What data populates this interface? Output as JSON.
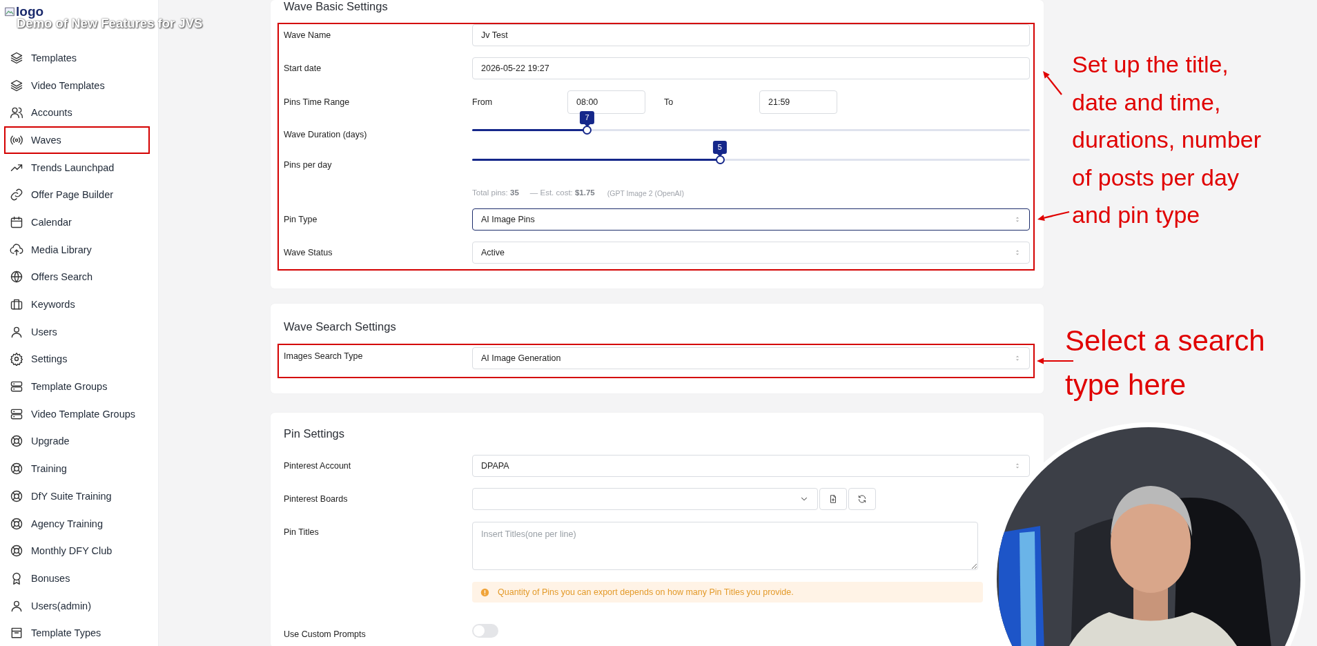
{
  "logo": {
    "alt_text": "logo"
  },
  "video_title": "Demo of New Features for JVS",
  "sidebar": {
    "items": [
      {
        "label": "Templates",
        "highlighted": false
      },
      {
        "label": "Video Templates",
        "highlighted": false
      },
      {
        "label": "Accounts",
        "highlighted": false
      },
      {
        "label": "Waves",
        "highlighted": true
      },
      {
        "label": "Trends Launchpad",
        "highlighted": false
      },
      {
        "label": "Offer Page Builder",
        "highlighted": false
      },
      {
        "label": "Calendar",
        "highlighted": false
      },
      {
        "label": "Media Library",
        "highlighted": false
      },
      {
        "label": "Offers Search",
        "highlighted": false
      },
      {
        "label": "Keywords",
        "highlighted": false
      },
      {
        "label": "Users",
        "highlighted": false
      },
      {
        "label": "Settings",
        "highlighted": false
      },
      {
        "label": "Template Groups",
        "highlighted": false
      },
      {
        "label": "Video Template Groups",
        "highlighted": false
      },
      {
        "label": "Upgrade",
        "highlighted": false
      },
      {
        "label": "Training",
        "highlighted": false
      },
      {
        "label": "DfY Suite Training",
        "highlighted": false
      },
      {
        "label": "Agency Training",
        "highlighted": false
      },
      {
        "label": "Monthly DFY Club",
        "highlighted": false
      },
      {
        "label": "Bonuses",
        "highlighted": false
      },
      {
        "label": "Users(admin)",
        "highlighted": false
      },
      {
        "label": "Template Types",
        "highlighted": false
      }
    ]
  },
  "sections": [
    {
      "title": "Wave Basic Settings",
      "highlighted": true,
      "fields": [
        {
          "kind": "input",
          "label": "Wave Name",
          "value": "Jv Test"
        },
        {
          "kind": "input",
          "label": "Start date",
          "value": "2026-05-22 19:27"
        },
        {
          "kind": "time_range",
          "label": "Pins Time Range",
          "from_label": "From",
          "from_value": "08:00",
          "to_label": "To",
          "to_value": "21:59"
        },
        {
          "kind": "slider",
          "label": "Wave Duration (days)",
          "level": 0.206,
          "reading": "7"
        },
        {
          "kind": "slider",
          "label": "Pins per day",
          "level": 0.444,
          "reading": "5"
        },
        {
          "kind": "summary",
          "total": "Total pins: **35**",
          "cost": "— Est. cost: **$1.75**",
          "model": "(GPT Image 2 (OpenAI)"
        },
        {
          "kind": "select",
          "label": "Pin Type",
          "value": "AI Image Pins",
          "focused": true
        },
        {
          "kind": "select",
          "label": "Wave Status",
          "value": "Active",
          "focused": false
        }
      ]
    },
    {
      "title": "Wave Search Settings",
      "highlighted": true,
      "fields": [
        {
          "kind": "select",
          "label": "Images Search Type",
          "value": "AI Image Generation",
          "focused": false
        }
      ]
    },
    {
      "title": "Pin Settings",
      "highlighted": false,
      "fields": [
        {
          "kind": "select",
          "label": "Pinterest Account",
          "value": "DPAPA",
          "focused": false
        },
        {
          "kind": "board_picker",
          "label": "Pinterest Boards"
        },
        {
          "kind": "textarea",
          "label": "Pin Titles",
          "placeholder": "Insert Titles(one per line)"
        },
        {
          "kind": "alert",
          "text": "Quantity of Pins you can export depends on how many Pin Titles you provide."
        },
        {
          "kind": "toggle",
          "label": "Use Custom Prompts",
          "on": false
        }
      ]
    }
  ],
  "annotations": [
    {
      "text": "Set up the title,\ndate and time,\ndurations, number\nof posts per day\nand pin type"
    },
    {
      "text": "Select a search\ntype here"
    }
  ]
}
